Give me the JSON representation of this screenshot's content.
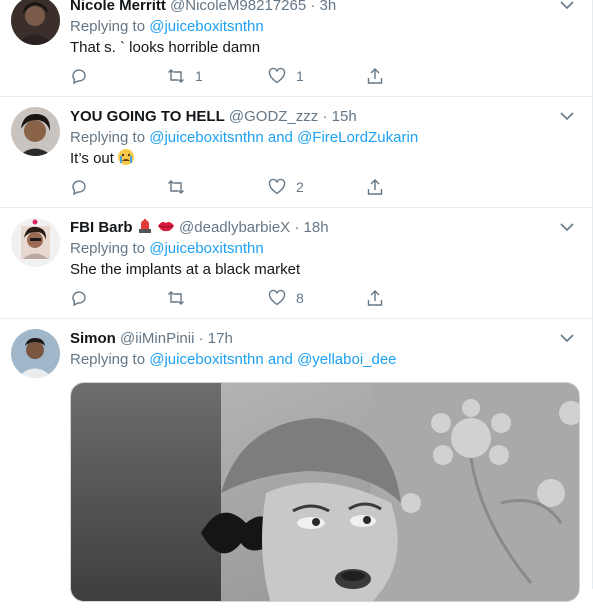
{
  "colors": {
    "link": "#1da1f2",
    "muted": "#657786",
    "text": "#14171a",
    "border": "#e6ecf0"
  },
  "tweets": [
    {
      "name": "Nicole Merritt",
      "handle": "@NicoleM98217265",
      "dot": "·",
      "time": "3h",
      "reply_prefix": "Replying to",
      "mentions": [
        "@juiceboxitsnthn"
      ],
      "text": "That s.  ` looks horrible damn",
      "retweets": "1",
      "likes": "1"
    },
    {
      "name": "YOU GOING TO HELL",
      "handle": "@GODZ_zzz",
      "dot": "·",
      "time": "15h",
      "reply_prefix": "Replying to",
      "mentions": [
        "@juiceboxitsnthn",
        "@FireLordZukarin"
      ],
      "conjunction": "and",
      "text": "It’s out",
      "emoji": "crying-face-emoji",
      "retweets": "",
      "likes": "2"
    },
    {
      "name": "FBI Barb",
      "badges": [
        "siren-emoji",
        "lips-emoji"
      ],
      "handle": "@deadlybarbieX",
      "dot": "·",
      "time": "18h",
      "reply_prefix": "Replying to",
      "mentions": [
        "@juiceboxitsnthn"
      ],
      "text": "She the implants at a black market",
      "retweets": "",
      "likes": "8"
    },
    {
      "name": "Simon",
      "handle": "@iiMinPinii",
      "dot": "·",
      "time": "17h",
      "reply_prefix": "Replying to",
      "mentions": [
        "@juiceboxitsnthn",
        "@yellaboi_dee"
      ],
      "conjunction": "and",
      "media": "black-and-white-gif-photo"
    }
  ]
}
